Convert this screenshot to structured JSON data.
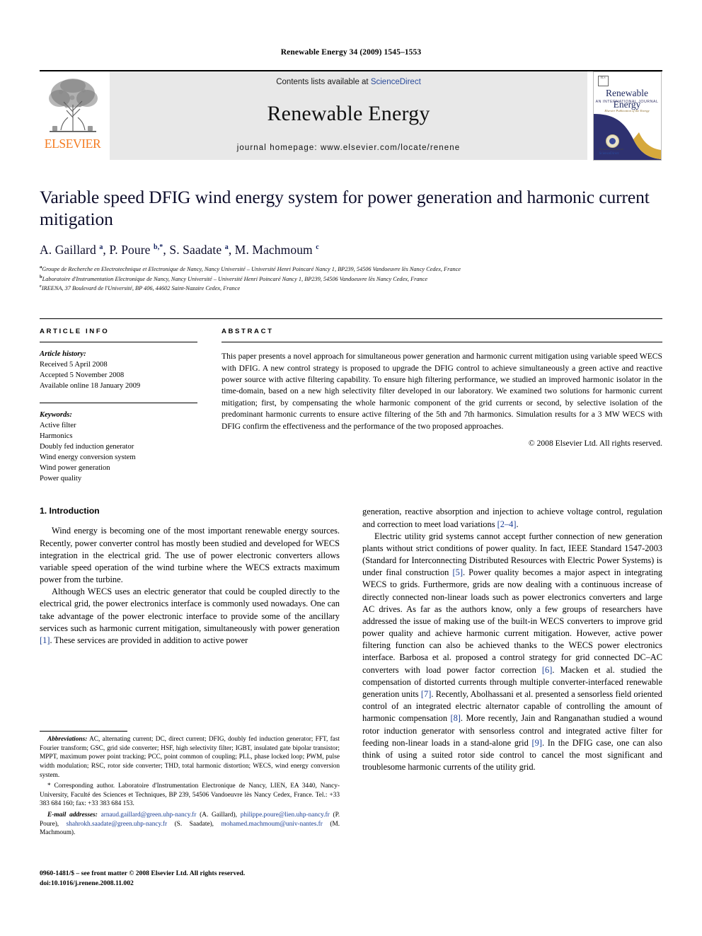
{
  "running_head": "Renewable Energy 34 (2009) 1545–1553",
  "masthead": {
    "publisher_word": "ELSEVIER",
    "contents_prefix": "Contents lists available at ",
    "contents_link": "ScienceDirect",
    "journal_name": "Renewable Energy",
    "homepage": "journal homepage: www.elsevier.com/locate/renene",
    "cover": {
      "title": "Renewable Energy",
      "subtitle": "AN INTERNATIONAL JOURNAL",
      "tagline": "Elsevier Publication of the Energy",
      "corner_mark": "ELS",
      "foot_small": "An international journal",
      "foot_link": "ScienceDirect"
    }
  },
  "article": {
    "title": "Variable speed DFIG wind energy system for power generation and harmonic current mitigation",
    "authors_html": "A. Gaillard <sup>a</sup>, P. Poure <sup>b,</sup><sup>*</sup>, S. Saadate <sup>a</sup>, M. Machmoum <sup>c</sup>",
    "affiliations": [
      {
        "mark": "a",
        "text": "Groupe de Recherche en Electrotechnique et Electronique de Nancy, Nancy Université – Université Henri Poincaré Nancy 1, BP239, 54506 Vandoeuvre lès Nancy Cedex, France"
      },
      {
        "mark": "b",
        "text": "Laboratoire d'Instrumentation Electronique de Nancy, Nancy Université – Université Henri Poincaré Nancy 1, BP239, 54506 Vandoeuvre lès Nancy Cedex, France"
      },
      {
        "mark": "c",
        "text": "IREENA, 37 Boulevard de l'Université, BP 406, 44602 Saint-Nazaire Cedex, France"
      }
    ]
  },
  "article_info": {
    "label": "ARTICLE INFO",
    "history_label": "Article history:",
    "history": [
      "Received 5 April 2008",
      "Accepted 5 November 2008",
      "Available online 18 January 2009"
    ],
    "keywords_label": "Keywords:",
    "keywords": [
      "Active filter",
      "Harmonics",
      "Doubly fed induction generator",
      "Wind energy conversion system",
      "Wind power generation",
      "Power quality"
    ]
  },
  "abstract": {
    "label": "ABSTRACT",
    "text": "This paper presents a novel approach for simultaneous power generation and harmonic current mitigation using variable speed WECS with DFIG. A new control strategy is proposed to upgrade the DFIG control to achieve simultaneously a green active and reactive power source with active filtering capability. To ensure high filtering performance, we studied an improved harmonic isolator in the time-domain, based on a new high selectivity filter developed in our laboratory. We examined two solutions for harmonic current mitigation; first, by compensating the whole harmonic component of the grid currents or second, by selective isolation of the predominant harmonic currents to ensure active filtering of the 5th and 7th harmonics. Simulation results for a 3 MW WECS with DFIG confirm the effectiveness and the performance of the two proposed approaches.",
    "copyright": "© 2008 Elsevier Ltd. All rights reserved."
  },
  "body": {
    "section_number_title": "1. Introduction",
    "left_paragraphs": [
      "Wind energy is becoming one of the most important renewable energy sources. Recently, power converter control has mostly been studied and developed for WECS integration in the electrical grid. The use of power electronic converters allows variable speed operation of the wind turbine where the WECS extracts maximum power from the turbine.",
      "Although WECS uses an electric generator that could be coupled directly to the electrical grid, the power electronics interface is commonly used nowadays. One can take advantage of the power electronic interface to provide some of the ancillary services such as harmonic current mitigation, simultaneously with power generation [1]. These services are provided in addition to active power"
    ],
    "right_paragraphs": [
      "generation, reactive absorption and injection to achieve voltage control, regulation and correction to meet load variations [2–4].",
      "Electric utility grid systems cannot accept further connection of new generation plants without strict conditions of power quality. In fact, IEEE Standard 1547-2003 (Standard for Interconnecting Distributed Resources with Electric Power Systems) is under final construction [5]. Power quality becomes a major aspect in integrating WECS to grids. Furthermore, grids are now dealing with a continuous increase of directly connected non-linear loads such as power electronics converters and large AC drives. As far as the authors know, only a few groups of researchers have addressed the issue of making use of the built-in WECS converters to improve grid power quality and achieve harmonic current mitigation. However, active power filtering function can also be achieved thanks to the WECS power electronics interface. Barbosa et al. proposed a control strategy for grid connected DC–AC converters with load power factor correction [6]. Macken et al. studied the compensation of distorted currents through multiple converter-interfaced renewable generation units [7]. Recently, Abolhassani et al. presented a sensorless field oriented control of an integrated electric alternator capable of controlling the amount of harmonic compensation [8]. More recently, Jain and Ranganathan studied a wound rotor induction generator with sensorless control and integrated active filter for feeding non-linear loads in a stand-alone grid [9]. In the DFIG case, one can also think of using a suited rotor side control to cancel the most significant and troublesome harmonic currents of the utility grid."
    ]
  },
  "footnotes": {
    "abbreviations_label": "Abbreviations:",
    "abbreviations_text": "AC, alternating current; DC, direct current; DFIG, doubly fed induction generator; FFT, fast Fourier transform; GSC, grid side converter; HSF, high selectivity filter; IGBT, insulated gate bipolar transistor; MPPT, maximum power point tracking; PCC, point common of coupling; PLL, phase locked loop; PWM, pulse width modulation; RSC, rotor side converter; THD, total harmonic distortion; WECS, wind energy conversion system.",
    "corresponding_text": "* Corresponding author. Laboratoire d'Instrumentation Electronique de Nancy, LIEN, EA 3440, Nancy-University, Faculté des Sciences et Techniques, BP 239, 54506 Vandoeuvre lès Nancy Cedex, France. Tel.: +33 383 684 160; fax: +33 383 684 153.",
    "email_label": "E-mail addresses:",
    "emails": [
      {
        "address": "arnaud.gaillard@green.uhp-nancy.fr",
        "person": "(A. Gaillard),"
      },
      {
        "address": "philippe.poure@lien.uhp-nancy.fr",
        "person": "(P. Poure),"
      },
      {
        "address": "shahrokh.saadate@green.uhp-nancy.fr",
        "person": "(S. Saadate),"
      },
      {
        "address": "mohamed.machmoum@univ-nantes.fr",
        "person": "(M. Machmoum)."
      }
    ]
  },
  "footer": {
    "issn_line": "0960-1481/$ – see front matter © 2008 Elsevier Ltd. All rights reserved.",
    "doi_line": "doi:10.1016/j.renene.2008.11.002"
  }
}
